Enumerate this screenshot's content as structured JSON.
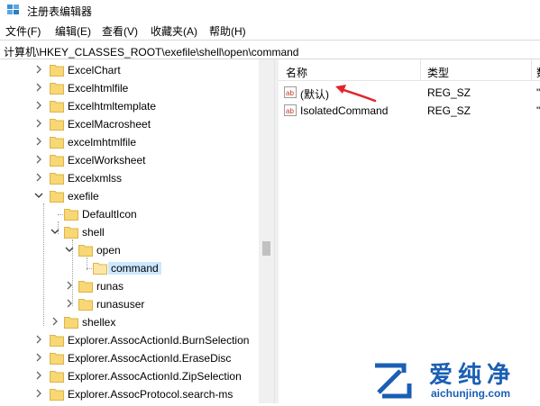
{
  "window": {
    "title": "注册表编辑器"
  },
  "menu": [
    "文件(F)",
    "编辑(E)",
    "查看(V)",
    "收藏夹(A)",
    "帮助(H)"
  ],
  "address": "计算机\\HKEY_CLASSES_ROOT\\exefile\\shell\\open\\command",
  "tree": [
    {
      "label": "ExcelChart"
    },
    {
      "label": "Excelhtmlfile"
    },
    {
      "label": "Excelhtmltemplate"
    },
    {
      "label": "ExcelMacrosheet"
    },
    {
      "label": "excelmhtmlfile"
    },
    {
      "label": "ExcelWorksheet"
    },
    {
      "label": "Excelxmlss"
    },
    {
      "label": "exefile"
    },
    {
      "label": "DefaultIcon"
    },
    {
      "label": "shell"
    },
    {
      "label": "open"
    },
    {
      "label": "command"
    },
    {
      "label": "runas"
    },
    {
      "label": "runasuser"
    },
    {
      "label": "shellex"
    },
    {
      "label": "Explorer.AssocActionId.BurnSelection"
    },
    {
      "label": "Explorer.AssocActionId.EraseDisc"
    },
    {
      "label": "Explorer.AssocActionId.ZipSelection"
    },
    {
      "label": "Explorer.AssocProtocol.search-ms"
    }
  ],
  "list": {
    "columns": [
      "名称",
      "类型",
      "数"
    ],
    "rows": [
      {
        "name": "(默认)",
        "type": "REG_SZ",
        "data": "\""
      },
      {
        "name": "IsolatedCommand",
        "type": "REG_SZ",
        "data": "\""
      }
    ]
  },
  "watermark": {
    "brand": "爱纯净",
    "url": "aichunjing.com"
  },
  "colors": {
    "selection": "#cce8ff",
    "arrow": "#e0262b",
    "folder": "#f8d775",
    "watermark_blue": "#1a5fb4"
  }
}
